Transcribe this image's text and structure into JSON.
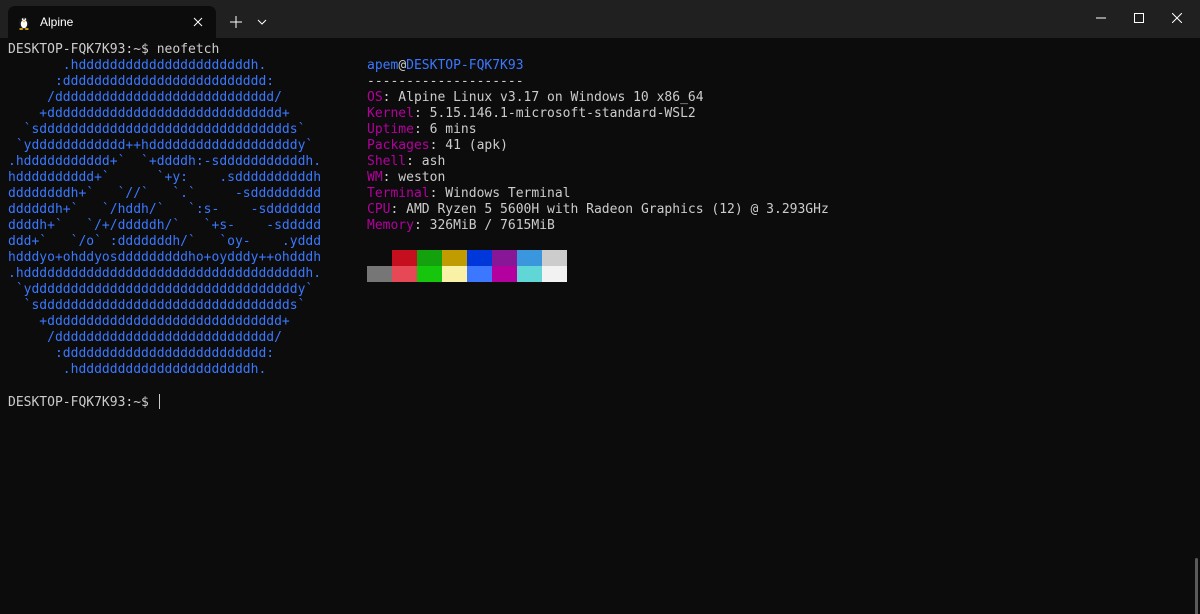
{
  "titlebar": {
    "tab_title": "Alpine",
    "tab_icon": "penguin-icon",
    "new_tab_icon": "plus-icon",
    "dropdown_icon": "chevron-down-icon",
    "minimize_icon": "minimize-icon",
    "maximize_icon": "maximize-icon",
    "close_icon": "close-icon"
  },
  "terminal": {
    "prompt": "DESKTOP-FQK7K93:~$",
    "command": "neofetch",
    "logo_color": "#3b78ff",
    "logo_lines": [
      "       .hddddddddddddddddddddddh.",
      "      :dddddddddddddddddddddddddd:",
      "     /dddddddddddddddddddddddddddd/",
      "    +dddddddddddddddddddddddddddddd+",
      "  `sdddddddddddddddddddddddddddddddds`",
      " `ydddddddddddd++hdddddddddddddddddddy`",
      ".hddddddddddd+`  `+ddddh:-sdddddddddddh.",
      "hdddddddddd+`      `+y:    .sddddddddddh",
      "ddddddddh+`   `//`   `.`     -sddddddddd",
      "ddddddh+`   `/hddh/`   `:s-    -sddddddd",
      "ddddh+`   `/+/dddddh/`   `+s-    -sddddd",
      "ddd+`   `/o` :dddddddh/`   `oy-    .yddd",
      "hdddyo+ohddyosdddddddddho+oydddy++ohdddh",
      ".hddddddddddddddddddddddddddddddddddddh.",
      " `yddddddddddddddddddddddddddddddddddy`",
      "  `sdddddddddddddddddddddddddddddddds`",
      "    +dddddddddddddddddddddddddddddd+",
      "     /dddddddddddddddddddddddddddd/",
      "      :dddddddddddddddddddddddddd:",
      "       .hddddddddddddddddddddddh."
    ],
    "info": {
      "user": "apem",
      "at": "@",
      "host": "DESKTOP-FQK7K93",
      "separator": "--------------------",
      "rows": [
        {
          "key": "OS",
          "value": ": Alpine Linux v3.17 on Windows 10 x86_64"
        },
        {
          "key": "Kernel",
          "value": ": 5.15.146.1-microsoft-standard-WSL2"
        },
        {
          "key": "Uptime",
          "value": ": 6 mins"
        },
        {
          "key": "Packages",
          "value": ": 41 (apk)"
        },
        {
          "key": "Shell",
          "value": ": ash"
        },
        {
          "key": "WM",
          "value": ": weston"
        },
        {
          "key": "Terminal",
          "value": ": Windows Terminal"
        },
        {
          "key": "CPU",
          "value": ": AMD Ryzen 5 5600H with Radeon Graphics (12) @ 3.293GHz"
        },
        {
          "key": "Memory",
          "value": ": 326MiB / 7615MiB"
        }
      ],
      "key_color": "#b4009e"
    },
    "palette_top": [
      "#0c0c0c",
      "#c50f1f",
      "#13a10e",
      "#c19c00",
      "#0037da",
      "#881798",
      "#3a96dd",
      "#cccccc"
    ],
    "palette_bottom": [
      "#767676",
      "#e74856",
      "#16c60c",
      "#f9f1a5",
      "#3b78ff",
      "#b4009e",
      "#61d6d6",
      "#f2f2f2"
    ]
  }
}
